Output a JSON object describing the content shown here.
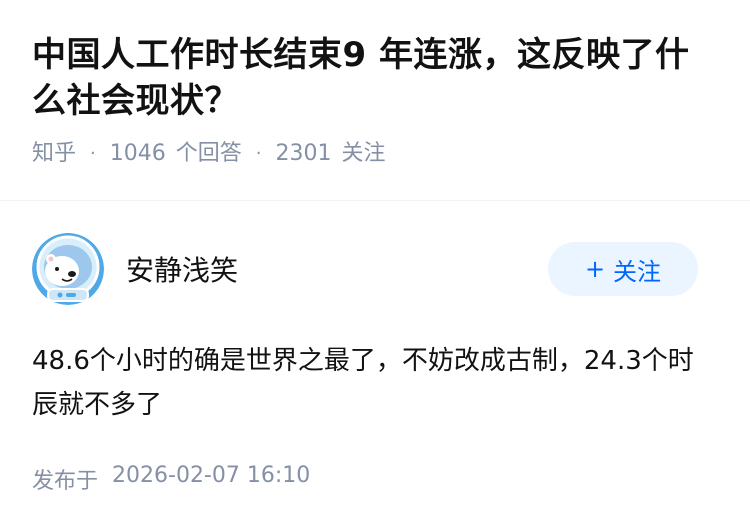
{
  "question": {
    "title": "中国人工作时长结束9 年连涨，这反映了什么社会现状？",
    "meta": {
      "source": "知乎",
      "answers_count": "1046",
      "answers_label": "个回答",
      "followers_count": "2301",
      "followers_label": "关注",
      "separator": "·"
    }
  },
  "answer": {
    "author": {
      "name": "安静浅笑",
      "avatar_icon": "polar-bear-astronaut-avatar"
    },
    "follow_button": {
      "plus": "+",
      "label": "关注"
    },
    "body": "48.6个小时的确是世界之最了，不妨改成古制，24.3个时辰就不多了",
    "publish": {
      "label": "发布于",
      "datetime": "2026-02-07 16:10"
    }
  },
  "colors": {
    "meta_gray": "#8590a6",
    "accent_blue": "#0066ff",
    "follow_bg": "#ebf5ff",
    "divider": "#f0f2f7"
  }
}
